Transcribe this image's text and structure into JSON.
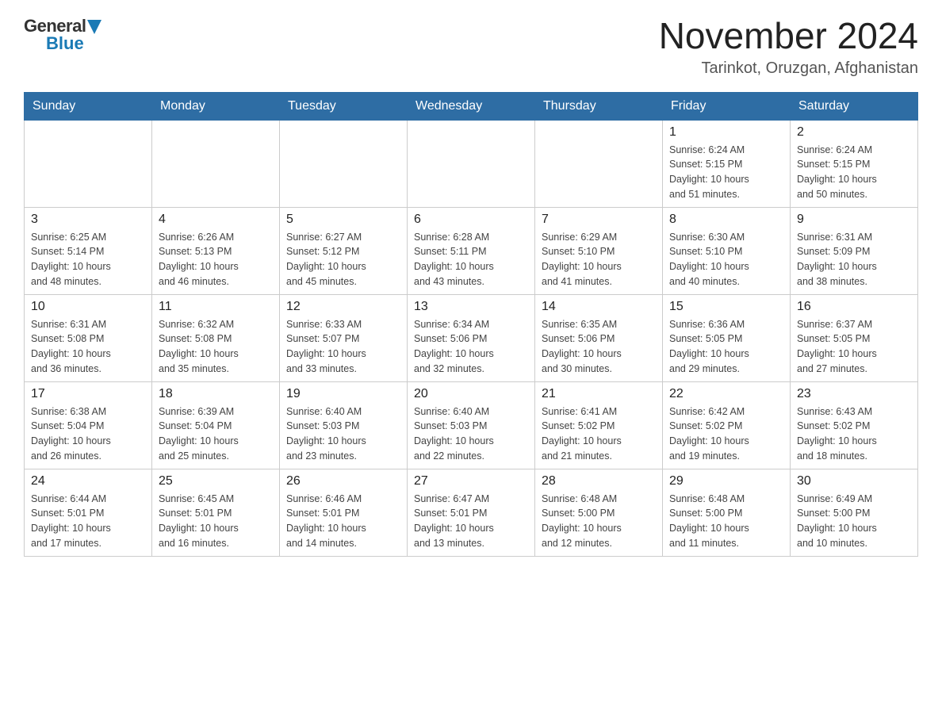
{
  "header": {
    "logo_general": "General",
    "logo_blue": "Blue",
    "month_year": "November 2024",
    "location": "Tarinkot, Oruzgan, Afghanistan"
  },
  "weekdays": [
    "Sunday",
    "Monday",
    "Tuesday",
    "Wednesday",
    "Thursday",
    "Friday",
    "Saturday"
  ],
  "weeks": [
    [
      {
        "day": "",
        "info": ""
      },
      {
        "day": "",
        "info": ""
      },
      {
        "day": "",
        "info": ""
      },
      {
        "day": "",
        "info": ""
      },
      {
        "day": "",
        "info": ""
      },
      {
        "day": "1",
        "info": "Sunrise: 6:24 AM\nSunset: 5:15 PM\nDaylight: 10 hours\nand 51 minutes."
      },
      {
        "day": "2",
        "info": "Sunrise: 6:24 AM\nSunset: 5:15 PM\nDaylight: 10 hours\nand 50 minutes."
      }
    ],
    [
      {
        "day": "3",
        "info": "Sunrise: 6:25 AM\nSunset: 5:14 PM\nDaylight: 10 hours\nand 48 minutes."
      },
      {
        "day": "4",
        "info": "Sunrise: 6:26 AM\nSunset: 5:13 PM\nDaylight: 10 hours\nand 46 minutes."
      },
      {
        "day": "5",
        "info": "Sunrise: 6:27 AM\nSunset: 5:12 PM\nDaylight: 10 hours\nand 45 minutes."
      },
      {
        "day": "6",
        "info": "Sunrise: 6:28 AM\nSunset: 5:11 PM\nDaylight: 10 hours\nand 43 minutes."
      },
      {
        "day": "7",
        "info": "Sunrise: 6:29 AM\nSunset: 5:10 PM\nDaylight: 10 hours\nand 41 minutes."
      },
      {
        "day": "8",
        "info": "Sunrise: 6:30 AM\nSunset: 5:10 PM\nDaylight: 10 hours\nand 40 minutes."
      },
      {
        "day": "9",
        "info": "Sunrise: 6:31 AM\nSunset: 5:09 PM\nDaylight: 10 hours\nand 38 minutes."
      }
    ],
    [
      {
        "day": "10",
        "info": "Sunrise: 6:31 AM\nSunset: 5:08 PM\nDaylight: 10 hours\nand 36 minutes."
      },
      {
        "day": "11",
        "info": "Sunrise: 6:32 AM\nSunset: 5:08 PM\nDaylight: 10 hours\nand 35 minutes."
      },
      {
        "day": "12",
        "info": "Sunrise: 6:33 AM\nSunset: 5:07 PM\nDaylight: 10 hours\nand 33 minutes."
      },
      {
        "day": "13",
        "info": "Sunrise: 6:34 AM\nSunset: 5:06 PM\nDaylight: 10 hours\nand 32 minutes."
      },
      {
        "day": "14",
        "info": "Sunrise: 6:35 AM\nSunset: 5:06 PM\nDaylight: 10 hours\nand 30 minutes."
      },
      {
        "day": "15",
        "info": "Sunrise: 6:36 AM\nSunset: 5:05 PM\nDaylight: 10 hours\nand 29 minutes."
      },
      {
        "day": "16",
        "info": "Sunrise: 6:37 AM\nSunset: 5:05 PM\nDaylight: 10 hours\nand 27 minutes."
      }
    ],
    [
      {
        "day": "17",
        "info": "Sunrise: 6:38 AM\nSunset: 5:04 PM\nDaylight: 10 hours\nand 26 minutes."
      },
      {
        "day": "18",
        "info": "Sunrise: 6:39 AM\nSunset: 5:04 PM\nDaylight: 10 hours\nand 25 minutes."
      },
      {
        "day": "19",
        "info": "Sunrise: 6:40 AM\nSunset: 5:03 PM\nDaylight: 10 hours\nand 23 minutes."
      },
      {
        "day": "20",
        "info": "Sunrise: 6:40 AM\nSunset: 5:03 PM\nDaylight: 10 hours\nand 22 minutes."
      },
      {
        "day": "21",
        "info": "Sunrise: 6:41 AM\nSunset: 5:02 PM\nDaylight: 10 hours\nand 21 minutes."
      },
      {
        "day": "22",
        "info": "Sunrise: 6:42 AM\nSunset: 5:02 PM\nDaylight: 10 hours\nand 19 minutes."
      },
      {
        "day": "23",
        "info": "Sunrise: 6:43 AM\nSunset: 5:02 PM\nDaylight: 10 hours\nand 18 minutes."
      }
    ],
    [
      {
        "day": "24",
        "info": "Sunrise: 6:44 AM\nSunset: 5:01 PM\nDaylight: 10 hours\nand 17 minutes."
      },
      {
        "day": "25",
        "info": "Sunrise: 6:45 AM\nSunset: 5:01 PM\nDaylight: 10 hours\nand 16 minutes."
      },
      {
        "day": "26",
        "info": "Sunrise: 6:46 AM\nSunset: 5:01 PM\nDaylight: 10 hours\nand 14 minutes."
      },
      {
        "day": "27",
        "info": "Sunrise: 6:47 AM\nSunset: 5:01 PM\nDaylight: 10 hours\nand 13 minutes."
      },
      {
        "day": "28",
        "info": "Sunrise: 6:48 AM\nSunset: 5:00 PM\nDaylight: 10 hours\nand 12 minutes."
      },
      {
        "day": "29",
        "info": "Sunrise: 6:48 AM\nSunset: 5:00 PM\nDaylight: 10 hours\nand 11 minutes."
      },
      {
        "day": "30",
        "info": "Sunrise: 6:49 AM\nSunset: 5:00 PM\nDaylight: 10 hours\nand 10 minutes."
      }
    ]
  ]
}
